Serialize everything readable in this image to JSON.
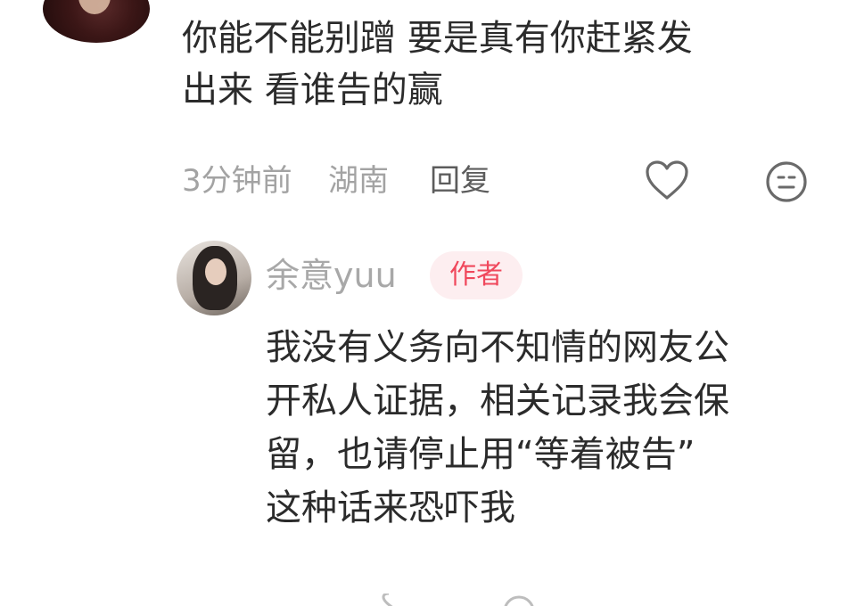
{
  "comment": {
    "text_lines": [
      "你能不能别蹭 要是真有你赶紧发",
      "出来 看谁告的赢"
    ],
    "time": "3分钟前",
    "location": "湖南",
    "reply_label": "回复",
    "icons": {
      "like": "heart-outline-icon",
      "dislike": "dislike-face-icon"
    }
  },
  "reply": {
    "author": "余意yuu",
    "badge": "作者",
    "text_lines": [
      "我没有义务向不知情的网友公",
      "开私人证据，相关记录我会保",
      "留，也请停止用“等着被告”",
      "这种话来恐吓我"
    ],
    "icons": {
      "like": "heart-outline-icon",
      "dislike": "dislike-face-icon"
    }
  },
  "colors": {
    "text_primary": "#2b2b2b",
    "text_meta": "#a3a3a3",
    "badge_bg": "#fdeef0",
    "badge_text": "#f0485c"
  }
}
